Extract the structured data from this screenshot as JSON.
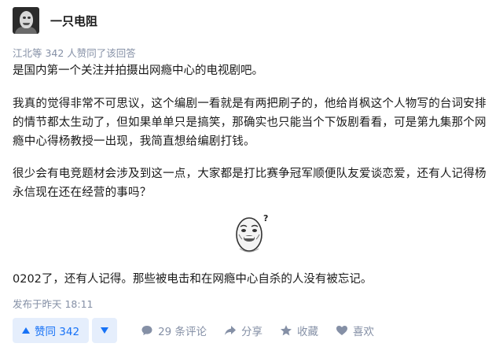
{
  "author": {
    "name": "一只电阻",
    "avatar_icon": "avatar-image"
  },
  "voters_line": "江北等 342 人赞同了该回答",
  "content": {
    "p1": "是国内第一个关注并拍摄出网瘾中心的电视剧吧。",
    "p2": "我真的觉得非常不可思议，这个编剧一看就是有两把刷子的，他给肖枫这个人物写的台词安排的情节都太生动了，但如果单单只是搞笑，那确实也只能当个下饭剧看看，可是第九集那个网瘾中心得杨教授一出现，我简直想给编剧打钱。",
    "p3": "很少会有电竞题材会涉及到这一点，大家都是打比赛争冠军顺便队友爱谈恋爱，还有人记得杨永信现在还在经营的事吗？",
    "sticker_icon": "confused-face-sticker",
    "p4": "0202了，还有人记得。那些被电击和在网瘾中心自杀的人没有被忘记。"
  },
  "published": "发布于昨天 18:11",
  "actions": {
    "upvote_label": "赞同 342",
    "comment_label": "29 条评论",
    "share_label": "分享",
    "favorite_label": "收藏",
    "like_label": "喜欢"
  },
  "colors": {
    "accent": "#1772f6",
    "accent_bg": "#e5eefc",
    "meta": "#8590a6"
  }
}
